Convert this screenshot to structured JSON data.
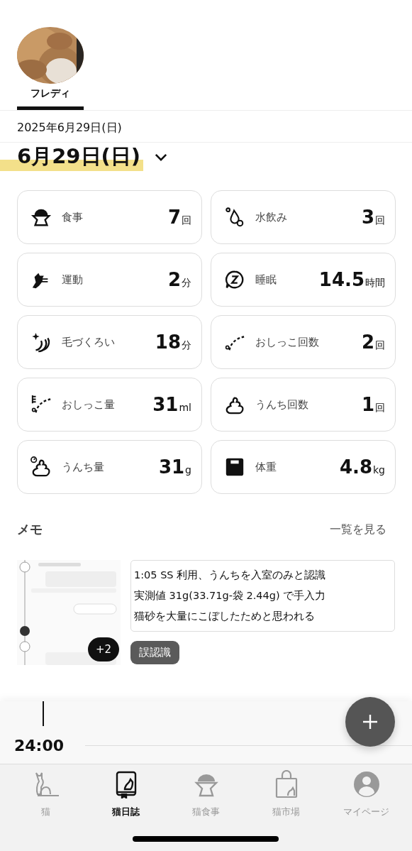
{
  "cats": [
    {
      "name": "フレディ",
      "selected": true
    }
  ],
  "date_full": "2025年6月29日(日)",
  "date_heading": "6月29日(日)",
  "stats": [
    {
      "kind": "food",
      "label": "食事",
      "value": "7",
      "unit": "回"
    },
    {
      "kind": "water",
      "label": "水飲み",
      "value": "3",
      "unit": "回"
    },
    {
      "kind": "exercise",
      "label": "運動",
      "value": "2",
      "unit": "分"
    },
    {
      "kind": "sleep",
      "label": "睡眠",
      "value": "14.5",
      "unit": "時間"
    },
    {
      "kind": "grooming",
      "label": "毛づくろい",
      "value": "18",
      "unit": "分"
    },
    {
      "kind": "pee_count",
      "label": "おしっこ回数",
      "value": "2",
      "unit": "回"
    },
    {
      "kind": "pee_amount",
      "label": "おしっこ量",
      "value": "31",
      "unit": "ml"
    },
    {
      "kind": "poop_count",
      "label": "うんち回数",
      "value": "1",
      "unit": "回"
    },
    {
      "kind": "poop_amount",
      "label": "うんち量",
      "value": "31",
      "unit": "g"
    },
    {
      "kind": "weight",
      "label": "体重",
      "value": "4.8",
      "unit": "kg"
    }
  ],
  "memo": {
    "title": "メモ",
    "link": "一覧を見る",
    "extra_count": "+2",
    "lines": [
      "1:05 SS 利用、うんちを入室のみと認識",
      "実測値 31g(33.71g-袋 2.44g) で手入力",
      "猫砂を大量にこぼしたためと思われる"
    ],
    "tag": "誤認識"
  },
  "timeline": {
    "time": "24:00"
  },
  "nav": [
    {
      "kind": "cat",
      "label": "猫",
      "selected": false
    },
    {
      "kind": "diary",
      "label": "猫日誌",
      "selected": true
    },
    {
      "kind": "bowl",
      "label": "猫食事",
      "selected": false
    },
    {
      "kind": "bag",
      "label": "猫市場",
      "selected": false
    },
    {
      "kind": "user",
      "label": "マイページ",
      "selected": false
    }
  ]
}
